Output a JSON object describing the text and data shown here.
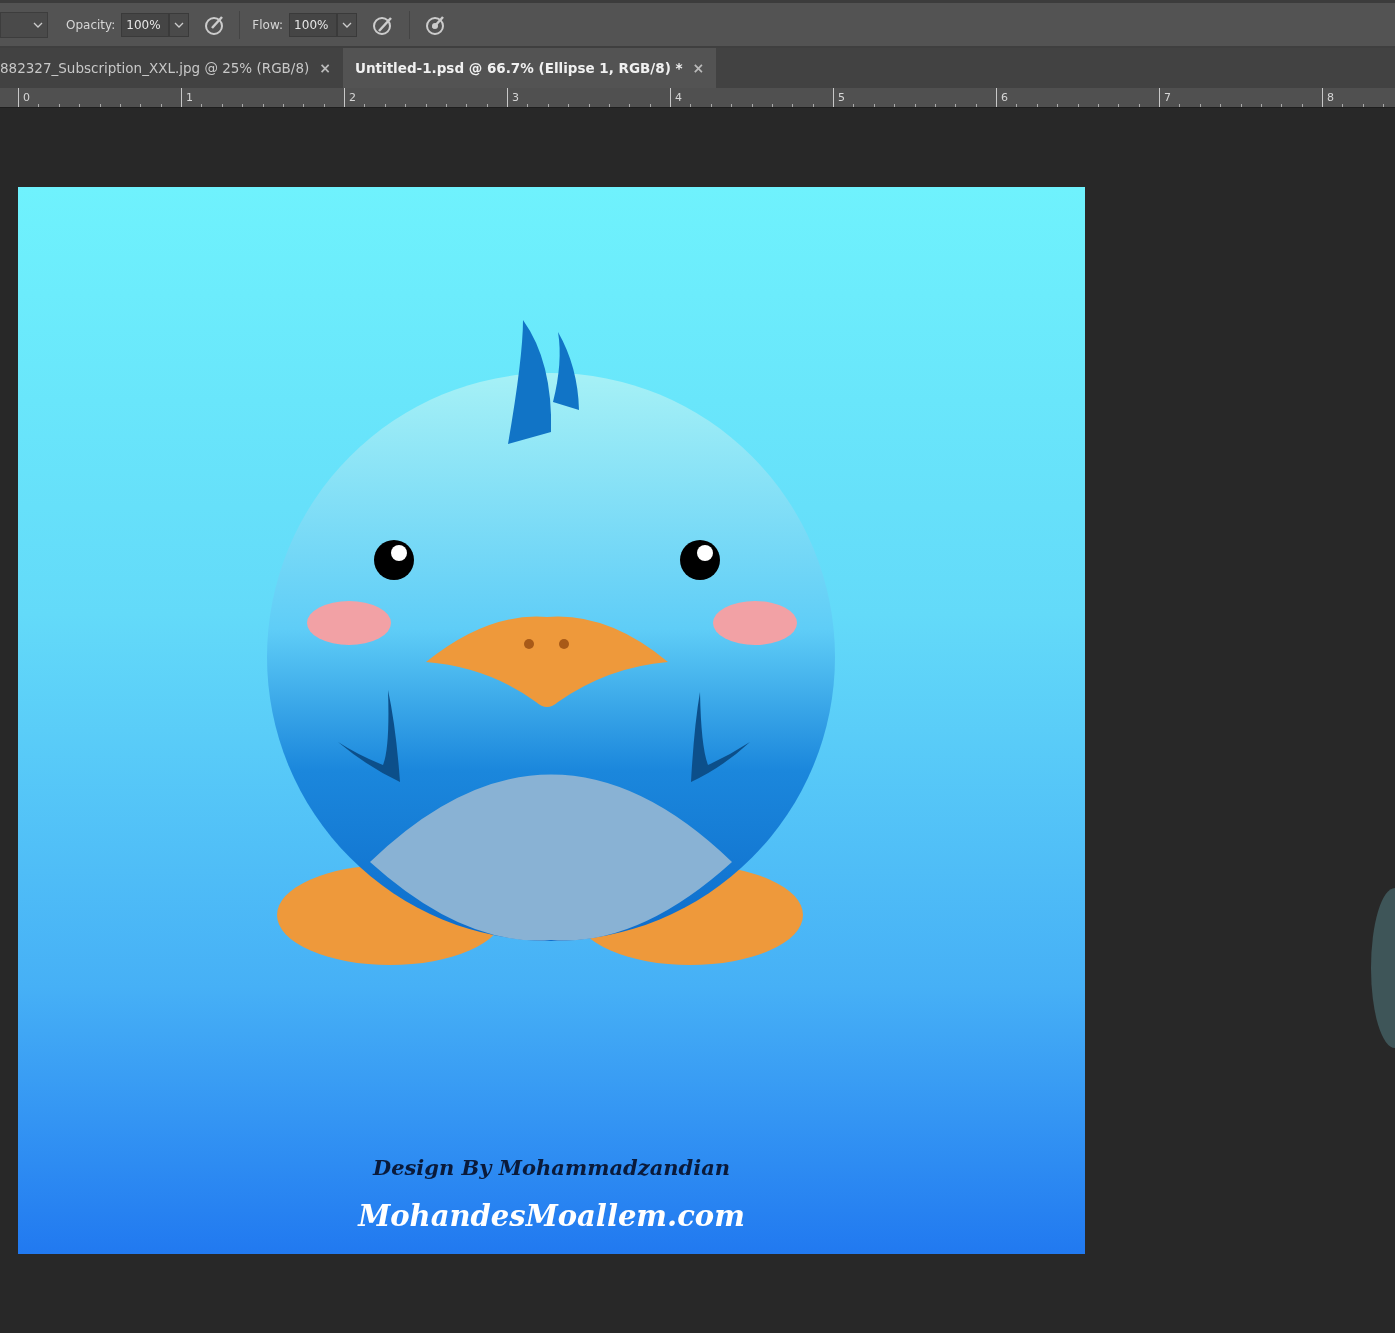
{
  "options_bar": {
    "opacity": {
      "label": "Opacity:",
      "value": "100%"
    },
    "flow": {
      "label": "Flow:",
      "value": "100%"
    }
  },
  "tabs": [
    {
      "label": "882327_Subscription_XXL.jpg @ 25% (RGB/8)",
      "close": "×",
      "selected": false
    },
    {
      "label": "Untitled-1.psd @ 66.7% (Ellipse 1, RGB/8) *",
      "close": "×",
      "selected": true
    }
  ],
  "ruler": {
    "labels": [
      "0",
      "1",
      "2",
      "3",
      "4",
      "5",
      "6",
      "7",
      "8"
    ]
  },
  "artwork": {
    "credit": "Design By Mohammadzandian",
    "site": "MohandesMoallem.com"
  }
}
